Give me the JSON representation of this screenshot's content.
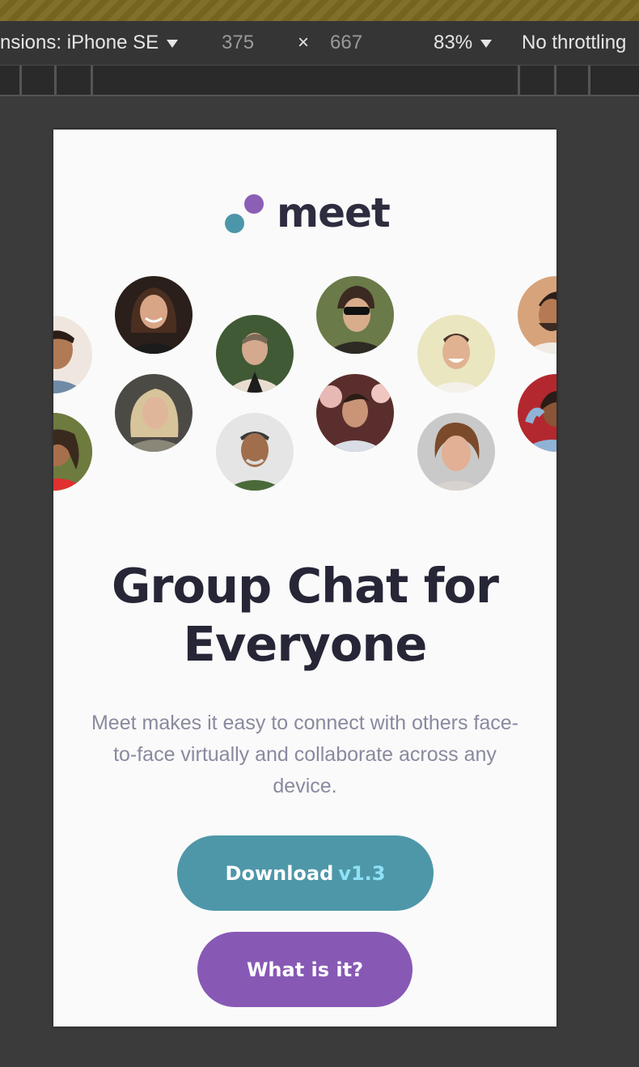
{
  "devtools": {
    "device_label": "nsions: iPhone SE",
    "width_value": "375",
    "times_sign": "×",
    "height_value": "667",
    "zoom_label": "83%",
    "throttling_label": "No throttling"
  },
  "page": {
    "logo_text": "meet",
    "headline_line1": "Group Chat for",
    "headline_line2": "Everyone",
    "description": "Meet makes it easy to connect with others face-to-face virtually and collaborate across any device.",
    "download_label": "Download",
    "download_version": "v1.3",
    "secondary_label": "What is it?"
  },
  "colors": {
    "brand_teal": "#4e97a9",
    "brand_purple": "#8759b5",
    "version_accent": "#8fe2f6",
    "heading": "#262637",
    "body_text": "#898a9f"
  }
}
